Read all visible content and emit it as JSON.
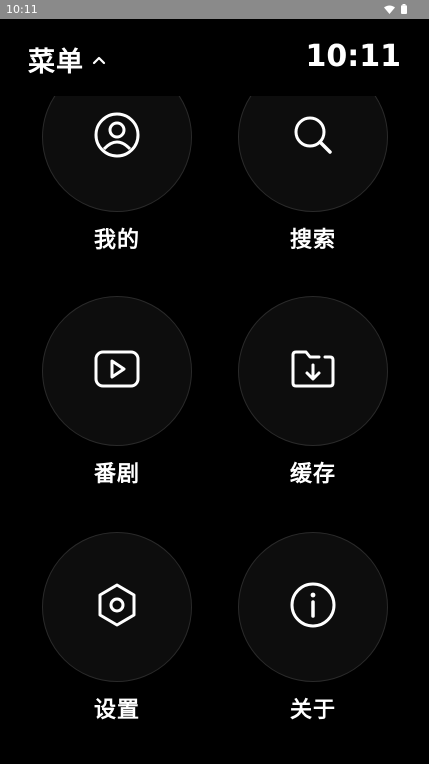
{
  "status_bar": {
    "time": "10:11",
    "icons": [
      "wifi-icon",
      "battery-icon"
    ]
  },
  "header": {
    "title": "菜单",
    "title_icon": "chevron-up-icon",
    "clock": "10:11"
  },
  "menu": {
    "items": [
      {
        "label": "我的",
        "icon": "user-icon"
      },
      {
        "label": "搜索",
        "icon": "search-icon"
      },
      {
        "label": "番剧",
        "icon": "play-icon"
      },
      {
        "label": "缓存",
        "icon": "folder-download-icon"
      },
      {
        "label": "设置",
        "icon": "settings-hexagon-icon"
      },
      {
        "label": "关于",
        "icon": "info-icon"
      }
    ]
  }
}
